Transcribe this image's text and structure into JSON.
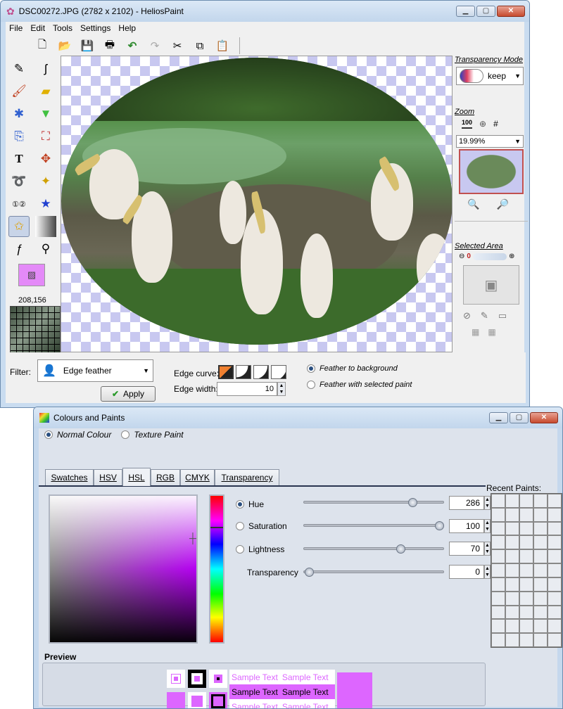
{
  "main_window": {
    "title": "DSC00272.JPG (2782 x 2102) - HeliosPaint",
    "menu": [
      "File",
      "Edit",
      "Tools",
      "Settings",
      "Help"
    ],
    "toolbar_icons": [
      "new-icon",
      "open-icon",
      "save-icon",
      "print-icon",
      "undo-icon",
      "redo-icon",
      "cut-icon",
      "copy-icon",
      "paste-icon"
    ],
    "coords": "208,156",
    "right_panel": {
      "transparency_mode_label": "Transparency Mode",
      "transparency_mode_value": "keep",
      "zoom_label": "Zoom",
      "zoom_value": "19.99%",
      "selected_area_label": "Selected Area"
    },
    "filter": {
      "label": "Filter:",
      "value": "Edge feather",
      "apply_label": "Apply",
      "edge_curve_label": "Edge curve:",
      "edge_width_label": "Edge width:",
      "edge_width_value": "10",
      "feather_bg_label": "Feather to background",
      "feather_paint_label": "Feather with selected paint",
      "selected_feather": "background"
    }
  },
  "colours_window": {
    "title": "Colours and Paints",
    "mode_normal": "Normal Colour",
    "mode_texture": "Texture Paint",
    "tabs": [
      "Swatches",
      "HSV",
      "HSL",
      "RGB",
      "CMYK",
      "Transparency"
    ],
    "selected_tab": "HSL",
    "recent_label": "Recent Paints:",
    "sliders": {
      "hue": {
        "label": "Hue",
        "value": "286"
      },
      "saturation": {
        "label": "Saturation",
        "value": "100"
      },
      "lightness": {
        "label": "Lightness",
        "value": "70"
      },
      "transparency": {
        "label": "Transparency",
        "value": "0"
      }
    },
    "preview_label": "Preview",
    "sample_text": "Sample Text",
    "colors": {
      "paint": "#dd66ff",
      "paint_light": "#e693f5"
    }
  }
}
